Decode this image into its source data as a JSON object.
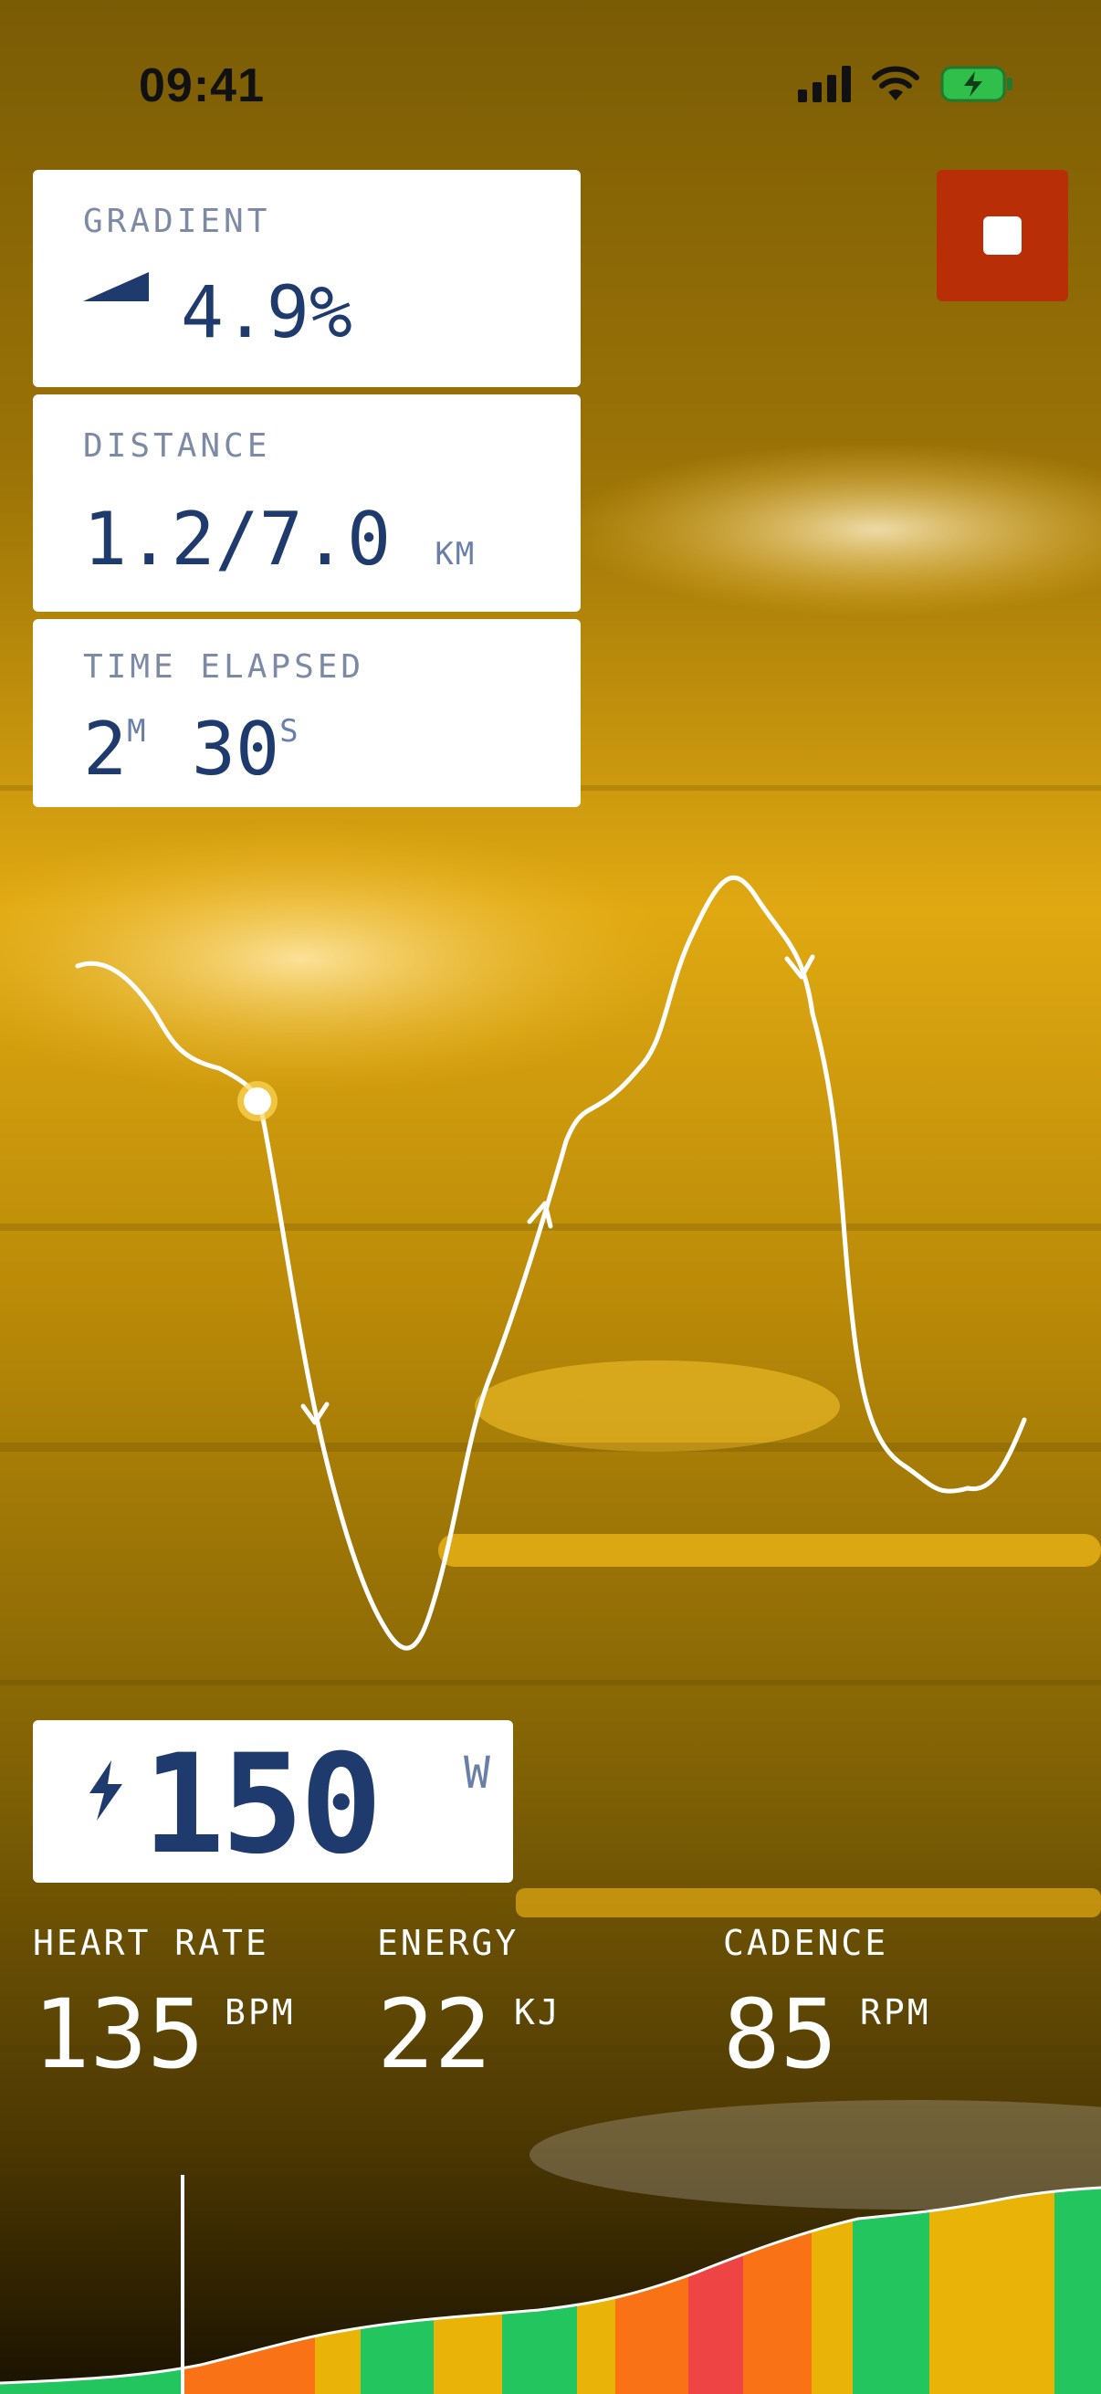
{
  "status_bar": {
    "time": "09:41"
  },
  "gradient": {
    "label": "GRADIENT",
    "value": "4.9%"
  },
  "distance": {
    "label": "DISTANCE",
    "value": "1.2/7.0",
    "unit": "KM"
  },
  "time_elapsed": {
    "label": "TIME ELAPSED",
    "minutes": "2",
    "minutes_unit": "M",
    "seconds": "30",
    "seconds_unit": "S"
  },
  "power": {
    "value": "150",
    "unit": "W",
    "icon": "lightning-icon"
  },
  "metrics": {
    "heart_rate": {
      "label": "HEART RATE",
      "value": "135",
      "unit": "BPM"
    },
    "energy": {
      "label": "ENERGY",
      "value": "22",
      "unit": "KJ"
    },
    "cadence": {
      "label": "CADENCE",
      "value": "85",
      "unit": "RPM"
    }
  },
  "colors": {
    "accent_dark": "#1f3b6e",
    "stop_button": "#b82e06",
    "zone_green": "#22c55e",
    "zone_yellow": "#eab308",
    "zone_orange": "#f97316",
    "zone_red": "#ef4444"
  },
  "icons": {
    "stop": "stop-icon",
    "gradient": "gradient-wedge-icon",
    "signal": "cellular-signal-icon",
    "wifi": "wifi-icon",
    "battery": "battery-charging-icon"
  }
}
